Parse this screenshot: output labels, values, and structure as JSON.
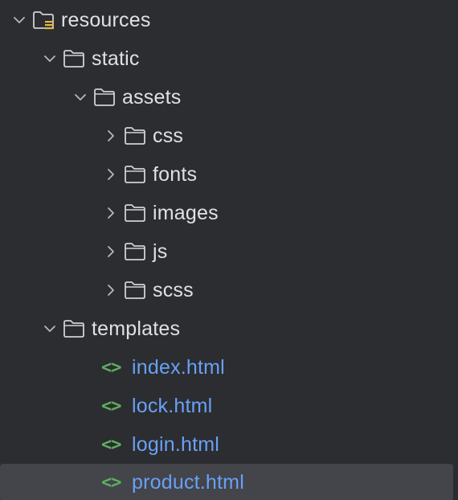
{
  "tree": {
    "rows": [
      {
        "label": "resources",
        "kind": "resource-folder",
        "expanded": true
      },
      {
        "label": "static",
        "kind": "folder",
        "expanded": true
      },
      {
        "label": "assets",
        "kind": "folder",
        "expanded": true
      },
      {
        "label": "css",
        "kind": "folder",
        "expanded": false
      },
      {
        "label": "fonts",
        "kind": "folder",
        "expanded": false
      },
      {
        "label": "images",
        "kind": "folder",
        "expanded": false
      },
      {
        "label": "js",
        "kind": "folder",
        "expanded": false
      },
      {
        "label": "scss",
        "kind": "folder",
        "expanded": false
      },
      {
        "label": "templates",
        "kind": "folder",
        "expanded": true
      },
      {
        "label": "index.html",
        "kind": "html-file"
      },
      {
        "label": "lock.html",
        "kind": "html-file"
      },
      {
        "label": "login.html",
        "kind": "html-file"
      },
      {
        "label": "product.html",
        "kind": "html-file",
        "selected": true
      }
    ],
    "html_icon_glyph": "<>"
  },
  "colors": {
    "background": "#2b2d30",
    "text": "#dfe1e5",
    "file_text": "#6aa0f7",
    "html_icon": "#5faf5f",
    "selection": "#43454a",
    "resource_marker": "#e0b94a"
  }
}
